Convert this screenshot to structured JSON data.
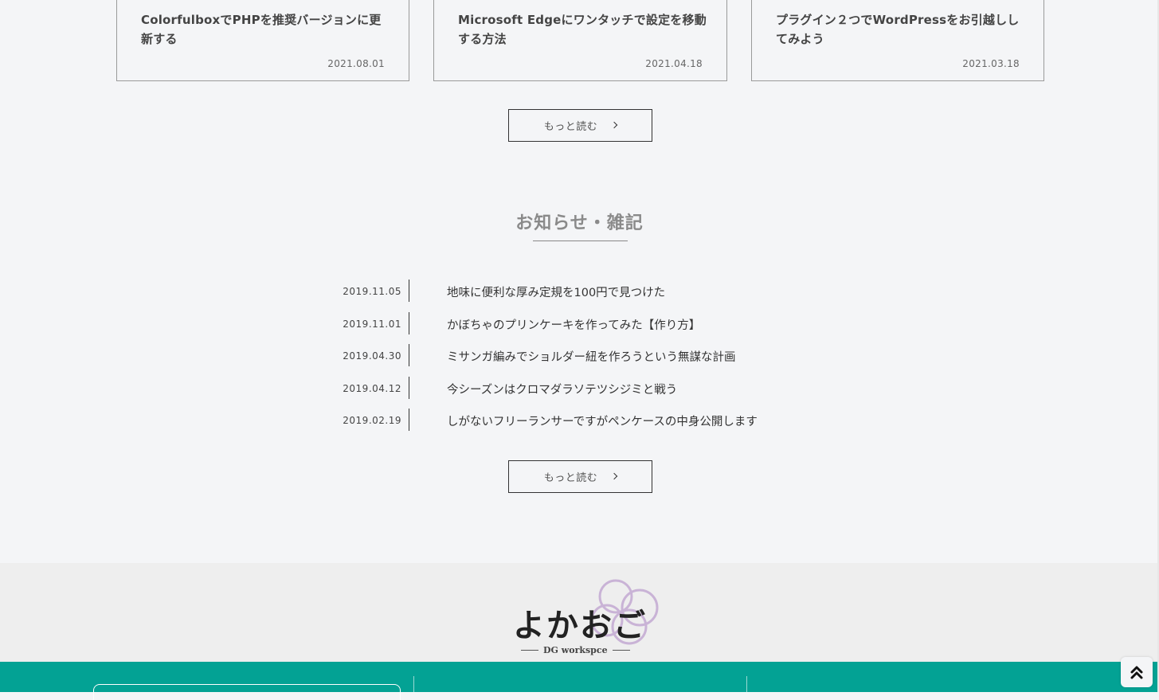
{
  "cards": [
    {
      "title": "ColorfulboxでPHPを推奨バージョンに更新する",
      "date": "2021.08.01"
    },
    {
      "title": "Microsoft Edgeにワンタッチで設定を移動する方法",
      "date": "2021.04.18"
    },
    {
      "title": "プラグイン２つでWordPressをお引越ししてみよう",
      "date": "2021.03.18"
    }
  ],
  "blog_more": {
    "label": "もっと読む",
    "icon": "chevron-right-icon"
  },
  "news": {
    "heading": "お知らせ・雑記",
    "items": [
      {
        "date": "2019.11.05",
        "title": "地味に便利な厚み定規を100円で見つけた"
      },
      {
        "date": "2019.11.01",
        "title": "かぼちゃのプリンケーキを作ってみた【作り方】"
      },
      {
        "date": "2019.04.30",
        "title": "ミサンガ編みでショルダー紐を作ろうという無謀な計画"
      },
      {
        "date": "2019.04.12",
        "title": "今シーズンはクロマダラソテツシジミと戦う"
      },
      {
        "date": "2019.02.19",
        "title": "しがないフリーランサーですがペンケースの中身公開します"
      }
    ],
    "more_label": "もっと読む"
  },
  "footer": {
    "logo_text": "よかおご",
    "logo_sub": "DG workspce",
    "logo_accent_color": "#c9b3d6",
    "band_color": "#03a294"
  },
  "to_top": {
    "icon": "double-chevron-up-icon"
  }
}
